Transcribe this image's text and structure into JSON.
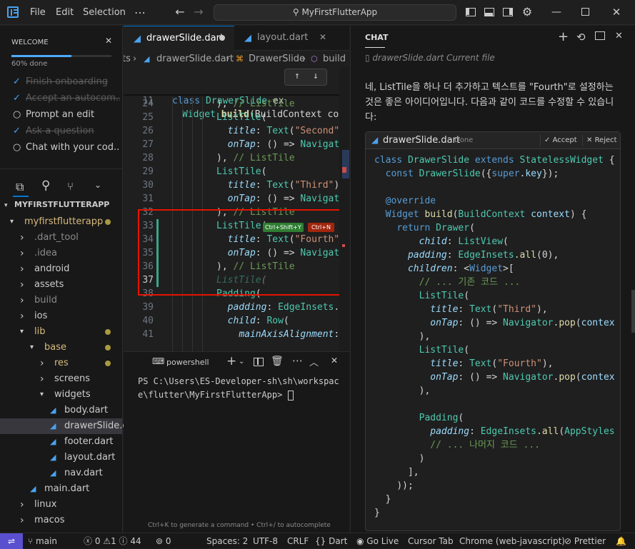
{
  "titlebar": {
    "menus": [
      "File",
      "Edit",
      "Selection"
    ],
    "command_center": "MyFirstFlutterApp",
    "icons": [
      "back-arrow-icon",
      "forward-arrow-icon",
      "toggle-sidebar-icon",
      "toggle-panel-icon",
      "toggle-secondary-sidebar-icon",
      "customize-layout-icon"
    ]
  },
  "onboarding": {
    "title": "WELCOME",
    "progress_text": "60% done",
    "progress": 0.6,
    "items": [
      {
        "label": "Finish onboarding",
        "done": true
      },
      {
        "label": "Accept an autocom...",
        "done": true
      },
      {
        "label": "Prompt an edit",
        "done": false
      },
      {
        "label": "Ask a question",
        "done": true
      },
      {
        "label": "Chat with your cod...",
        "done": false
      }
    ]
  },
  "explorer": {
    "root": "MYFIRSTFLUTTERAPP",
    "tree": [
      {
        "label": "myfirstflutterapp",
        "depth": 1,
        "kind": "folder-open",
        "modified": true
      },
      {
        "label": ".dart_tool",
        "depth": 2,
        "kind": "folder",
        "dim": true
      },
      {
        "label": ".idea",
        "depth": 2,
        "kind": "folder",
        "dim": true
      },
      {
        "label": "android",
        "depth": 2,
        "kind": "folder"
      },
      {
        "label": "assets",
        "depth": 2,
        "kind": "folder"
      },
      {
        "label": "build",
        "depth": 2,
        "kind": "folder",
        "dim": true
      },
      {
        "label": "ios",
        "depth": 2,
        "kind": "folder"
      },
      {
        "label": "lib",
        "depth": 2,
        "kind": "folder-open",
        "modified": true
      },
      {
        "label": "base",
        "depth": 3,
        "kind": "folder-open",
        "modified": true
      },
      {
        "label": "res",
        "depth": 4,
        "kind": "folder",
        "modified": true
      },
      {
        "label": "screens",
        "depth": 4,
        "kind": "folder"
      },
      {
        "label": "widgets",
        "depth": 4,
        "kind": "folder-open"
      },
      {
        "label": "body.dart",
        "depth": 5,
        "kind": "file"
      },
      {
        "label": "drawerSlide.dart",
        "depth": 5,
        "kind": "file",
        "selected": true
      },
      {
        "label": "footer.dart",
        "depth": 5,
        "kind": "file"
      },
      {
        "label": "layout.dart",
        "depth": 5,
        "kind": "file"
      },
      {
        "label": "nav.dart",
        "depth": 5,
        "kind": "file"
      },
      {
        "label": "main.dart",
        "depth": 3,
        "kind": "file"
      },
      {
        "label": "linux",
        "depth": 2,
        "kind": "folder"
      },
      {
        "label": "macos",
        "depth": 2,
        "kind": "folder"
      }
    ]
  },
  "editor": {
    "tabs": [
      {
        "label": "drawerSlide.dart",
        "active": true,
        "modified": true
      },
      {
        "label": "layout.dart",
        "active": false
      }
    ],
    "breadcrumb": [
      "ts",
      "drawerSlide.dart",
      "DrawerSlide",
      "build"
    ],
    "sticky": [
      {
        "num": "7",
        "code": "class DrawerSlide ex"
      },
      {
        "num": "11",
        "code": "  Widget build(BuildContext con"
      }
    ],
    "lines": [
      {
        "num": "24",
        "code": "), // ListTile"
      },
      {
        "num": "25",
        "code": "ListTile("
      },
      {
        "num": "26",
        "code": "  title: Text(\"Second\"),"
      },
      {
        "num": "27",
        "code": "  onTap: () => Navigator"
      },
      {
        "num": "28",
        "code": "), // ListTile"
      },
      {
        "num": "29",
        "code": "ListTile("
      },
      {
        "num": "30",
        "code": "  title: Text(\"Third\"),"
      },
      {
        "num": "31",
        "code": "  onTap: () => Navigator"
      },
      {
        "num": "32",
        "code": "), // ListTile"
      },
      {
        "num": "33",
        "code": "ListTile("
      },
      {
        "num": "34",
        "code": "  title: Text(\"Fourth\"),"
      },
      {
        "num": "35",
        "code": "  onTap: () => Navigator"
      },
      {
        "num": "36",
        "code": "), // ListTile"
      },
      {
        "num": "37",
        "code": "ListTile("
      },
      {
        "num": "38",
        "code": "Padding("
      },
      {
        "num": "39",
        "code": "  padding: EdgeInsets.al"
      },
      {
        "num": "40",
        "code": "  child: Row("
      },
      {
        "num": "41",
        "code": "    mainAxisAlignment: Ma"
      }
    ],
    "overlay_line": "onTap: () => Navigator",
    "accept_hint": "Ctrl+Shift+Y",
    "reject_hint": "Ctrl+N",
    "hint_text": "Ctrl+K to generate a command • Ctrl+/ to autocomplete"
  },
  "terminal": {
    "shell": "powershell",
    "prompt_line1": "PS C:\\Users\\ES-Developer-sh\\sh\\workspac",
    "prompt_line2": "e\\flutter\\MyFirstFlutterApp> "
  },
  "chat": {
    "title": "CHAT",
    "context_file": "drawerSlide.dart Current file",
    "message": "네, ListTile을 하나 더 추가하고 텍스트를 \"Fourth\"로 설정하는 것은 좋은 아이디어입니다. 다음과 같이 코드를 수정할 수 있습니다:",
    "code_file": "drawerSlide.dart",
    "code_status": "Done",
    "accept_label": "Accept",
    "reject_label": "Reject",
    "code_lines": [
      "class DrawerSlide extends StatelessWidget {",
      "  const DrawerSlide({super.key});",
      "",
      "  @override",
      "  Widget build(BuildContext context) {",
      "    return Drawer(",
      "        child: ListView(",
      "      padding: EdgeInsets.all(0),",
      "      children: <Widget>[",
      "        // ... 기존 코드 ...",
      "        ListTile(",
      "          title: Text(\"Third\"),",
      "          onTap: () => Navigator.pop(contex",
      "        ),",
      "        ListTile(",
      "          title: Text(\"Fourth\"),",
      "          onTap: () => Navigator.pop(contex",
      "        ),",
      "",
      "        Padding(",
      "          padding: EdgeInsets.all(AppStyles",
      "          // ... 나머지 코드 ...",
      "        )",
      "      ],",
      "    ));",
      "  }",
      "}"
    ]
  },
  "statusbar": {
    "branch": "main",
    "errors": "0",
    "warnings": "1",
    "infos": "44",
    "ports": "0",
    "spaces": "Spaces: 2",
    "encoding": "UTF-8",
    "eol": "CRLF",
    "language": "Dart",
    "golive": "Go Live",
    "cursor_tab": "Cursor Tab",
    "chrome": "Chrome (web-javascript)",
    "prettier": "Prettier"
  },
  "colors": {
    "accent": "#0078d4",
    "remote": "#5a4fcf",
    "added_line": "#2d4a2d",
    "highlight_box": "#e51400",
    "folder_modified": "#d7ba7d"
  }
}
